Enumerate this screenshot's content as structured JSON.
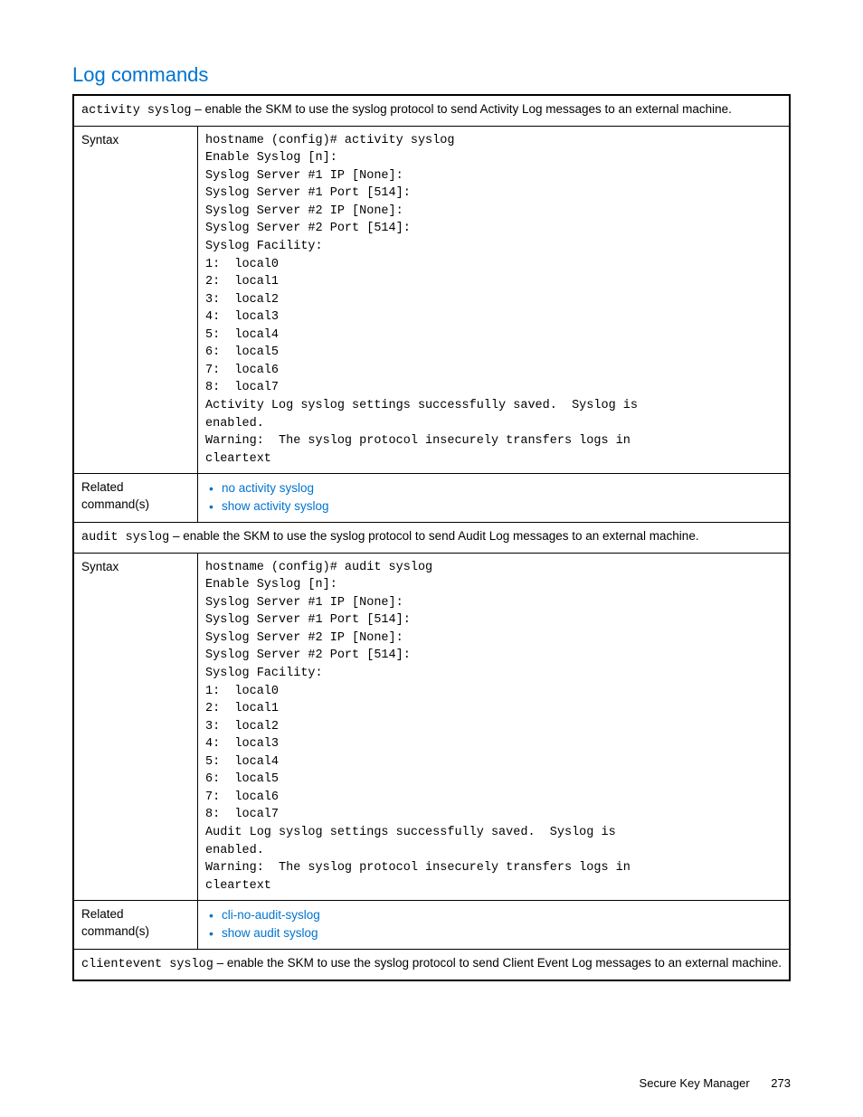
{
  "title": "Log commands",
  "rows": [
    {
      "type": "header",
      "cmd": "activity syslog",
      "desc": " – enable the SKM to use the syslog protocol to send Activity Log messages to an external machine."
    },
    {
      "type": "syntax",
      "label": "Syntax",
      "code": "hostname (config)# activity syslog\nEnable Syslog [n]:\nSyslog Server #1 IP [None]:\nSyslog Server #1 Port [514]:\nSyslog Server #2 IP [None]:\nSyslog Server #2 Port [514]:\nSyslog Facility:\n1:  local0\n2:  local1\n3:  local2\n4:  local3\n5:  local4\n6:  local5\n7:  local6\n8:  local7\nActivity Log syslog settings successfully saved.  Syslog is\nenabled.\nWarning:  The syslog protocol insecurely transfers logs in\ncleartext"
    },
    {
      "type": "related",
      "label": "Related command(s)",
      "links": [
        "no activity syslog",
        "show activity syslog"
      ]
    },
    {
      "type": "header",
      "cmd": "audit syslog",
      "desc": " – enable the SKM to use the syslog protocol to send Audit Log messages to an external machine."
    },
    {
      "type": "syntax",
      "label": "Syntax",
      "code": "hostname (config)# audit syslog\nEnable Syslog [n]:\nSyslog Server #1 IP [None]:\nSyslog Server #1 Port [514]:\nSyslog Server #2 IP [None]:\nSyslog Server #2 Port [514]:\nSyslog Facility:\n1:  local0\n2:  local1\n3:  local2\n4:  local3\n5:  local4\n6:  local5\n7:  local6\n8:  local7\nAudit Log syslog settings successfully saved.  Syslog is\nenabled.\nWarning:  The syslog protocol insecurely transfers logs in\ncleartext"
    },
    {
      "type": "related",
      "label": "Related command(s)",
      "links": [
        "cli-no-audit-syslog",
        "show audit syslog"
      ]
    },
    {
      "type": "header",
      "cmd": "clientevent syslog",
      "desc": " – enable the SKM to use the syslog protocol to send Client Event Log messages to an external machine."
    }
  ],
  "footer": {
    "text": "Secure Key Manager",
    "page": "273"
  }
}
